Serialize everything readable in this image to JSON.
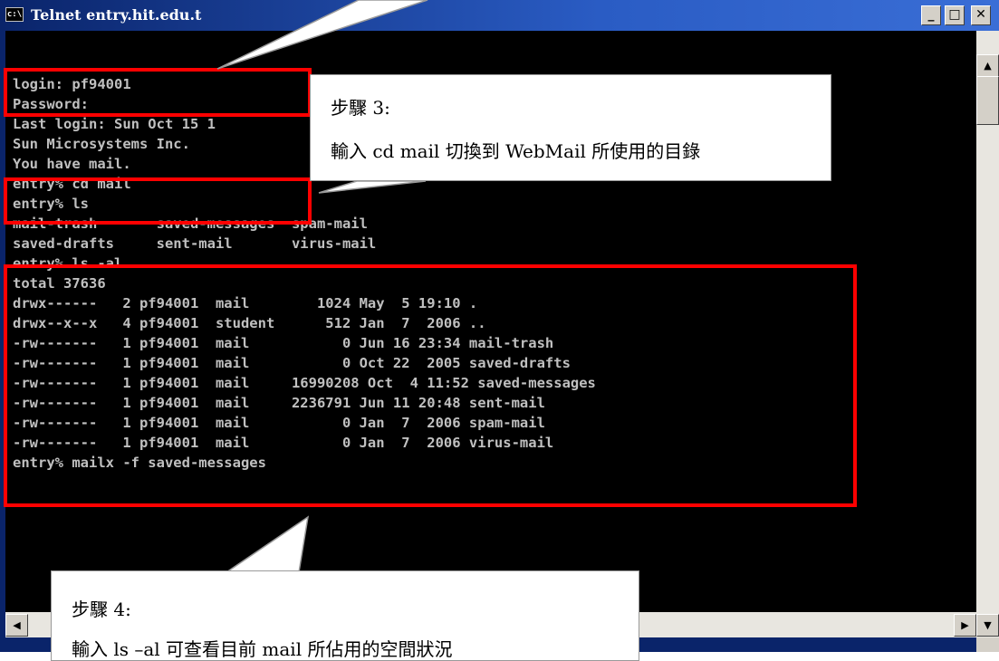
{
  "window": {
    "title": "Telnet entry.hit.edu.t",
    "icon_label": "c:\\",
    "minimize": "_",
    "maximize": "□",
    "close": "✕"
  },
  "terminal": {
    "lines": [
      "login: pf94001",
      "Password:",
      "Last login: Sun Oct 15 1",
      "Sun Microsystems Inc.",
      "You have mail.",
      "entry% cd mail",
      "entry% ls",
      "mail-trash       saved-messages  spam-mail",
      "saved-drafts     sent-mail       virus-mail",
      "entry% ls -al",
      "total 37636",
      "drwx------   2 pf94001  mail        1024 May  5 19:10 .",
      "drwx--x--x   4 pf94001  student      512 Jan  7  2006 ..",
      "-rw-------   1 pf94001  mail           0 Jun 16 23:34 mail-trash",
      "-rw-------   1 pf94001  mail           0 Oct 22  2005 saved-drafts",
      "-rw-------   1 pf94001  mail     16990208 Oct  4 11:52 saved-messages",
      "-rw-------   1 pf94001  mail     2236791 Jun 11 20:48 sent-mail",
      "-rw-------   1 pf94001  mail           0 Jan  7  2006 spam-mail",
      "-rw-------   1 pf94001  mail           0 Jan  7  2006 virus-mail",
      "entry% mailx -f saved-messages"
    ]
  },
  "callouts": {
    "step3": {
      "title": "步驟 3:",
      "body": "輸入 cd mail  切換到 WebMail 所使用的目錄"
    },
    "step4": {
      "title": "步驟 4:",
      "body": "輸入 ls –al  可查看目前 mail 所佔用的空間狀況"
    }
  },
  "colors": {
    "highlight": "#ff0000",
    "terminal_bg": "#000000",
    "terminal_fg": "#c0c0c0",
    "titlebar": "#0a246a"
  }
}
